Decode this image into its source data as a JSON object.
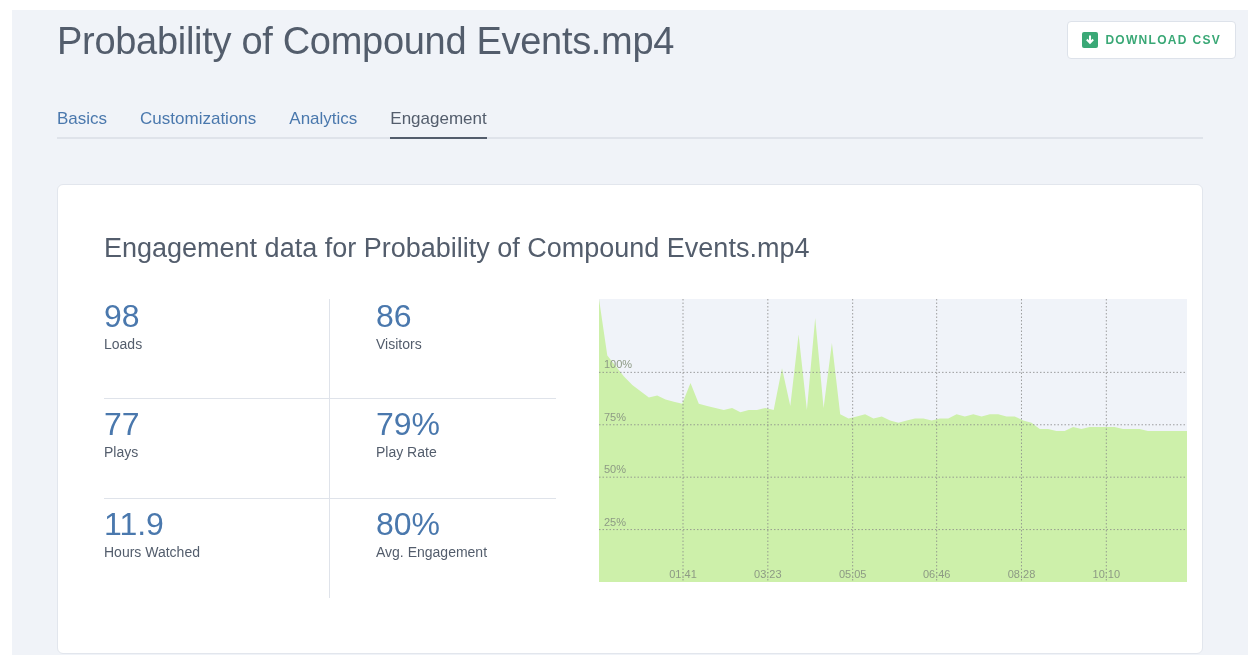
{
  "title": "Probability of Compound Events.mp4",
  "download_button": {
    "label": "DOWNLOAD CSV"
  },
  "tabs": [
    {
      "label": "Basics",
      "selected": false
    },
    {
      "label": "Customizations",
      "selected": false
    },
    {
      "label": "Analytics",
      "selected": false
    },
    {
      "label": "Engagement",
      "selected": true
    }
  ],
  "card": {
    "heading": "Engagement data for Probability of Compound Events.mp4",
    "stats": [
      {
        "value": "98",
        "label": "Loads"
      },
      {
        "value": "86",
        "label": "Visitors"
      },
      {
        "value": "77",
        "label": "Plays"
      },
      {
        "value": "79%",
        "label": "Play Rate"
      },
      {
        "value": "11.9",
        "label": "Hours Watched"
      },
      {
        "value": "80%",
        "label": "Avg. Engagement"
      }
    ],
    "chart_data": {
      "type": "area",
      "xlim": [
        0,
        707
      ],
      "ylim": [
        0,
        135
      ],
      "xticks": [
        {
          "value": 101,
          "label": "01:41"
        },
        {
          "value": 203,
          "label": "03:23"
        },
        {
          "value": 305,
          "label": "05:05"
        },
        {
          "value": 406,
          "label": "06:46"
        },
        {
          "value": 508,
          "label": "08:28"
        },
        {
          "value": 610,
          "label": "10:10"
        }
      ],
      "yticks": [
        {
          "value": 25,
          "label": "25%"
        },
        {
          "value": 50,
          "label": "50%"
        },
        {
          "value": 75,
          "label": "75%"
        },
        {
          "value": 100,
          "label": "100%"
        }
      ],
      "x": [
        0,
        10,
        20,
        30,
        40,
        50,
        60,
        70,
        80,
        90,
        100,
        110,
        120,
        130,
        140,
        150,
        160,
        170,
        180,
        190,
        200,
        210,
        220,
        230,
        240,
        250,
        260,
        270,
        280,
        290,
        300,
        310,
        320,
        330,
        340,
        350,
        360,
        370,
        380,
        390,
        400,
        410,
        420,
        430,
        440,
        450,
        460,
        470,
        480,
        490,
        500,
        510,
        520,
        530,
        540,
        550,
        560,
        570,
        580,
        590,
        600,
        610,
        620,
        630,
        640,
        650,
        660,
        670,
        680,
        690,
        700,
        707
      ],
      "grid": true,
      "series": [
        {
          "color": "#cdf0aa",
          "values": [
            135,
            108,
            103,
            98,
            94,
            91,
            88,
            89,
            87,
            86,
            85,
            95,
            85,
            84,
            83,
            82,
            83,
            81,
            82,
            82,
            83,
            82,
            102,
            84,
            118,
            82,
            126,
            83,
            114,
            80,
            78,
            79,
            80,
            78,
            79,
            77,
            76,
            77,
            78,
            78,
            77,
            78,
            78,
            80,
            79,
            80,
            79,
            80,
            80,
            79,
            79,
            77,
            76,
            73,
            73,
            72,
            72,
            74,
            73,
            74,
            74,
            74,
            74,
            73,
            73,
            73,
            72,
            72,
            72,
            72,
            72,
            72
          ]
        }
      ]
    }
  }
}
